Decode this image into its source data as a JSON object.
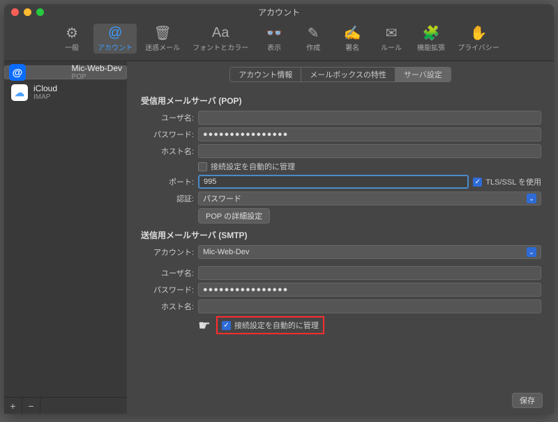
{
  "window": {
    "title": "アカウント"
  },
  "toolbar": {
    "items": [
      {
        "label": "一般"
      },
      {
        "label": "アカウント"
      },
      {
        "label": "迷惑メール"
      },
      {
        "label": "フォントとカラー"
      },
      {
        "label": "表示"
      },
      {
        "label": "作成"
      },
      {
        "label": "署名"
      },
      {
        "label": "ルール"
      },
      {
        "label": "機能拡張"
      },
      {
        "label": "プライバシー"
      }
    ]
  },
  "sidebar": {
    "accounts": [
      {
        "name": "Mic-Web-Dev",
        "protocol": "POP"
      },
      {
        "name": "iCloud",
        "protocol": "IMAP"
      }
    ]
  },
  "tabs": {
    "items": [
      {
        "label": "アカウント情報"
      },
      {
        "label": "メールボックスの特性"
      },
      {
        "label": "サーバ設定"
      }
    ]
  },
  "incoming": {
    "title": "受信用メールサーバ (POP)",
    "user_label": "ユーザ名:",
    "user_value": "",
    "password_label": "パスワード:",
    "password_value": "●●●●●●●●●●●●●●●●",
    "host_label": "ホスト名:",
    "host_value": "",
    "auto_manage_label": "接続設定を自動的に管理",
    "auto_manage_checked": false,
    "port_label": "ポート:",
    "port_value": "995",
    "tls_label": "TLS/SSL を使用",
    "tls_checked": true,
    "auth_label": "認証:",
    "auth_value": "パスワード",
    "advanced_btn": "POP の詳細設定"
  },
  "outgoing": {
    "title": "送信用メールサーバ (SMTP)",
    "account_label": "アカウント:",
    "account_value": "Mic-Web-Dev",
    "user_label": "ユーザ名:",
    "user_value": "",
    "password_label": "パスワード:",
    "password_value": "●●●●●●●●●●●●●●●●",
    "host_label": "ホスト名:",
    "host_value": "",
    "auto_manage_label": "接続設定を自動的に管理",
    "auto_manage_checked": true
  },
  "footer": {
    "save": "保存"
  }
}
